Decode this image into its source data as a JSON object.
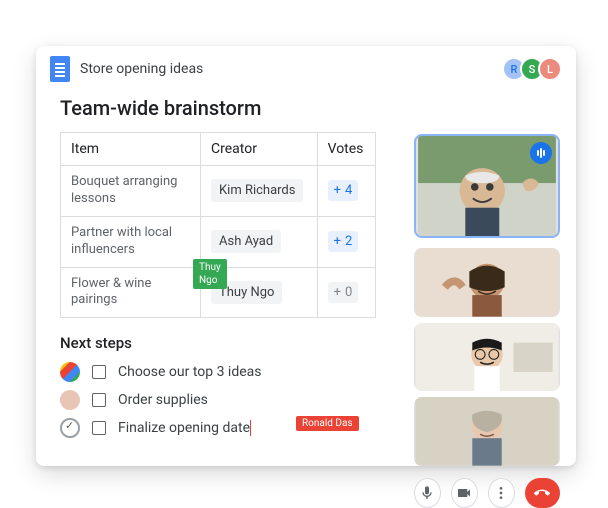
{
  "header": {
    "title": "Store opening ideas",
    "avatars": [
      "R",
      "S",
      "L"
    ]
  },
  "section1": {
    "title": "Team-wide brainstorm",
    "columns": [
      "Item",
      "Creator",
      "Votes"
    ],
    "rows": [
      {
        "item": "Bouquet arranging lessons",
        "creator": "Kim Richards",
        "votes": 4,
        "style": "blue"
      },
      {
        "item": "Partner with local influencers",
        "creator": "Ash Ayad",
        "votes": 2,
        "style": "blue"
      },
      {
        "item": "Flower & wine pairings",
        "creator": "Thuy Ngo",
        "votes": 0,
        "style": "gray"
      }
    ],
    "cursor_tag_green": "Thuy Ngo"
  },
  "section2": {
    "title": "Next steps",
    "tasks": [
      {
        "label": "Choose our top 3 ideas",
        "assignee": "group"
      },
      {
        "label": "Order supplies",
        "assignee": "p1"
      },
      {
        "label": "Finalize opening date",
        "assignee": "check"
      }
    ],
    "cursor_tag_red": "Ronald Das"
  },
  "video": {
    "participants": [
      {
        "name": "participant-1",
        "speaking": true
      },
      {
        "name": "participant-2",
        "speaking": false
      },
      {
        "name": "participant-3",
        "speaking": false
      },
      {
        "name": "participant-4",
        "speaking": false
      }
    ],
    "controls": [
      "mic",
      "camera",
      "more",
      "hangup"
    ]
  }
}
